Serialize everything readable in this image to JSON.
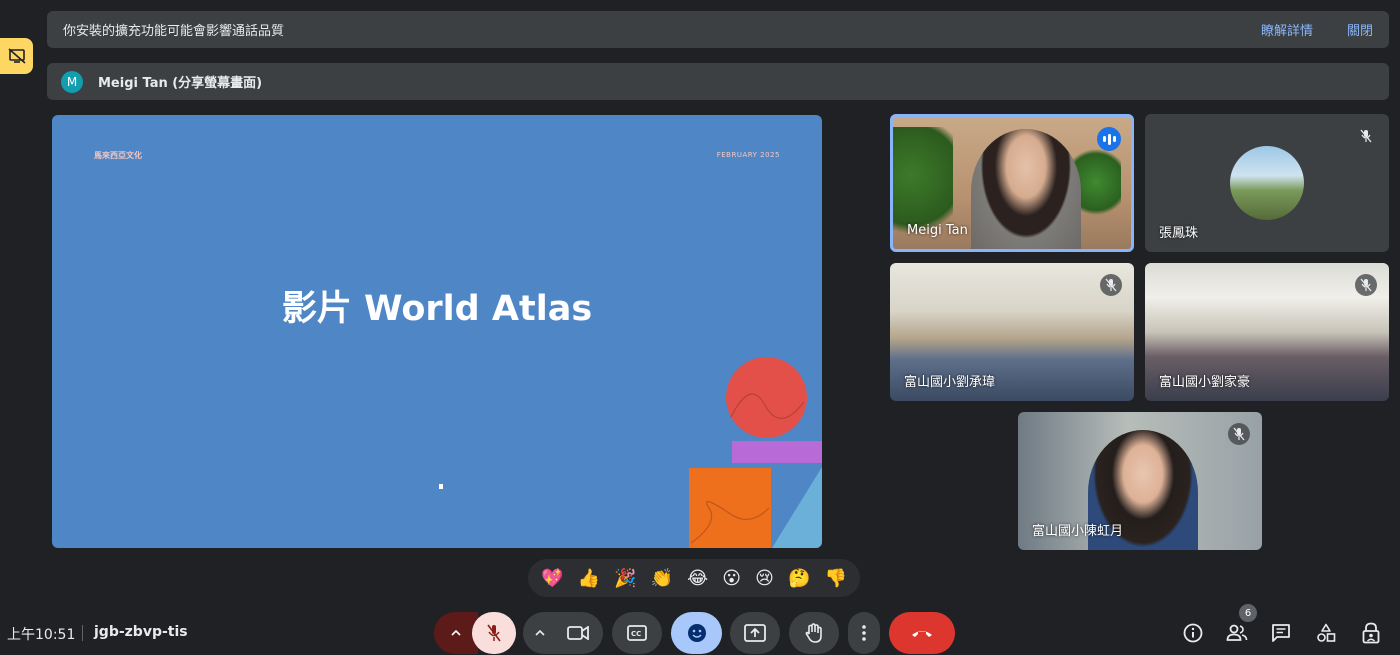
{
  "notice": {
    "message": "你安裝的擴充功能可能會影響通話品質",
    "learn_more": "瞭解詳情",
    "close": "關閉"
  },
  "presenter": {
    "avatar_letter": "M",
    "label": "Meigi Tan (分享螢幕畫面)"
  },
  "slide": {
    "brand": "馬來西亞文化",
    "date": "FEBRUARY 2025",
    "title": "影片 World Atlas"
  },
  "participants": [
    {
      "name": "Meigi Tan",
      "state": "speaking"
    },
    {
      "name": "張鳳珠",
      "state": "muted"
    },
    {
      "name": "富山國小劉承瑋",
      "state": "muted"
    },
    {
      "name": "富山國小劉家豪",
      "state": "muted"
    },
    {
      "name": "富山國小陳虹月",
      "state": "muted"
    }
  ],
  "reactions": [
    "💖",
    "👍",
    "🎉",
    "👏",
    "😂",
    "😮",
    "😢",
    "🤔",
    "👎"
  ],
  "bottom_bar": {
    "time": "上午10:51",
    "meeting_code": "jgb-zbvp-tis",
    "participant_count": "6"
  },
  "colors": {
    "background": "#202124",
    "slide_bg": "#4f86c6",
    "end_call": "#dc362e",
    "accent": "#8ab4f8",
    "emoji_active": "#a8c7fa"
  }
}
